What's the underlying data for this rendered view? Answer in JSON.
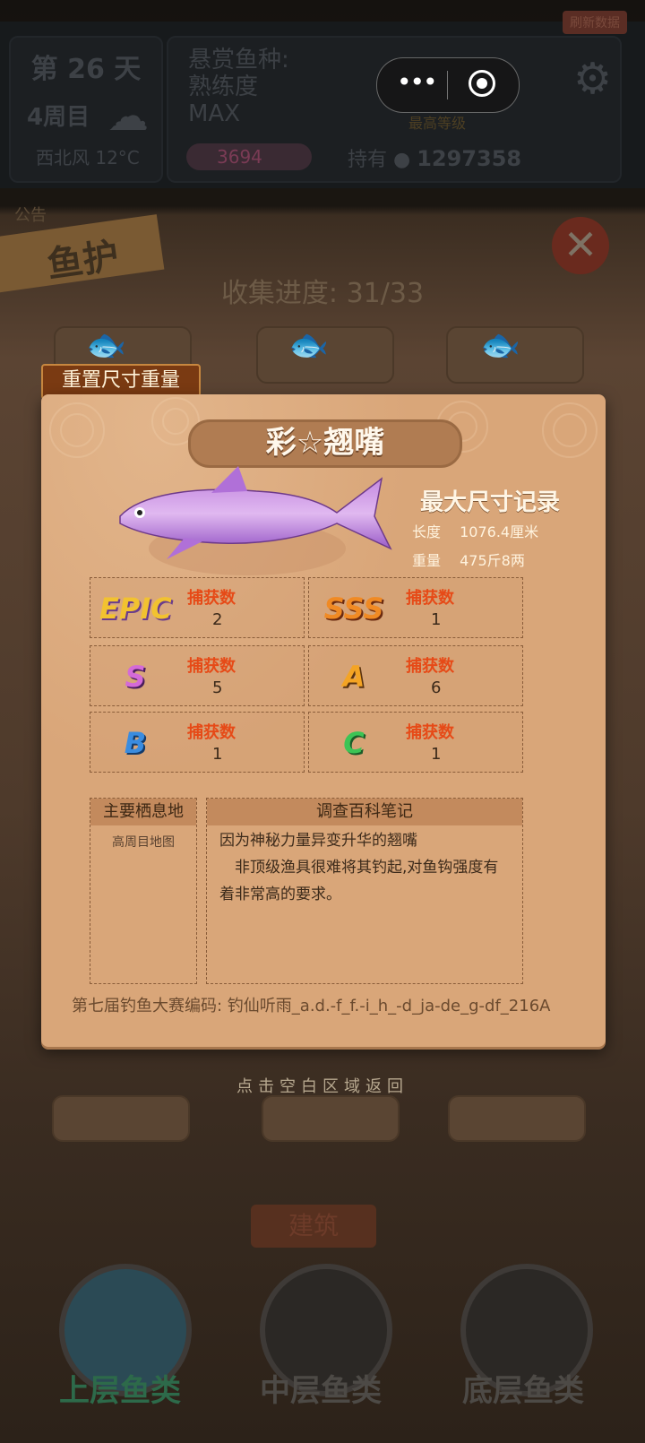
{
  "top": {
    "day": "第 26 天",
    "week": "4周目",
    "wind": "西北风 12°C",
    "bounty_label_1": "悬赏鱼种:",
    "bounty_label_2": "熟练度",
    "bounty_label_3": "MAX",
    "hp": "3694",
    "hold_label": "持有",
    "coins": "1297358",
    "max_level": "最高等级",
    "refresh": "刷新数据"
  },
  "board": {
    "notice": "公告",
    "banner": "鱼护",
    "progress": "收集进度: 31/33",
    "hint": "点击空白区域返回",
    "build": "建筑"
  },
  "nav": {
    "upper": "上层鱼类",
    "middle": "中层鱼类",
    "bottom": "底层鱼类"
  },
  "modal": {
    "reset_tab": "重置尺寸重量",
    "title": "彩☆翘嘴",
    "record_title": "最大尺寸记录",
    "length_label": "长度",
    "length_value": "1076.4厘米",
    "weight_label": "重量",
    "weight_value": "475斤8两",
    "stats": [
      {
        "grade": "EPIC",
        "label": "捕获数",
        "count": "2",
        "color": "#f2c230"
      },
      {
        "grade": "SSS",
        "label": "捕获数",
        "count": "1",
        "color": "#f08a24"
      },
      {
        "grade": "S",
        "label": "捕获数",
        "count": "5",
        "color": "#d46ad8"
      },
      {
        "grade": "A",
        "label": "捕获数",
        "count": "6",
        "color": "#f4a424"
      },
      {
        "grade": "B",
        "label": "捕获数",
        "count": "1",
        "color": "#3a8ce0"
      },
      {
        "grade": "C",
        "label": "捕获数",
        "count": "1",
        "color": "#3cc455"
      }
    ],
    "habitat_head": "主要栖息地",
    "habitat_body": "高周目地图",
    "notes_head": "调查百科笔记",
    "notes_line1": "因为神秘力量异变升华的翘嘴",
    "notes_line2": "　非顶级渔具很难将其钓起,对鱼钩强度有着非常高的要求。",
    "code": "第七届钓鱼大赛编码: 钓仙听雨_a.d.-f_f.-i_h_-d_ja-de_g-df_216A"
  }
}
